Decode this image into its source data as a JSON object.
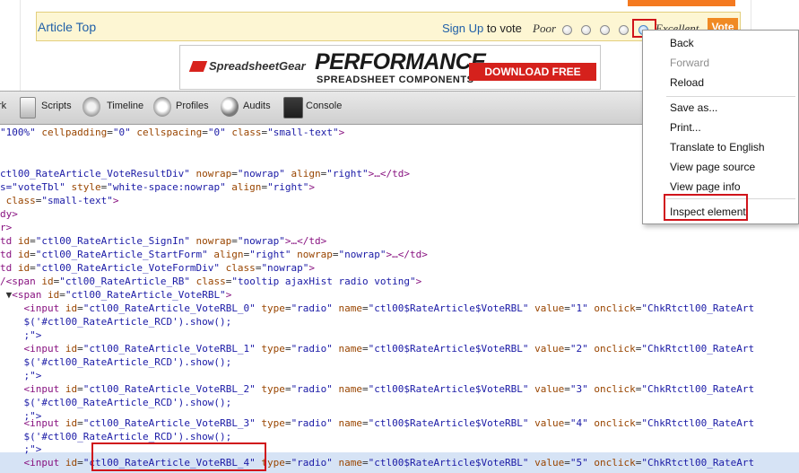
{
  "page": {
    "article_top": "Article Top",
    "sign_up": "Sign Up",
    "to_vote": "to vote",
    "poor_label": "Poor",
    "excellent_label": "Excellent",
    "vote_label": "Vote"
  },
  "ad": {
    "brand": "SpreadsheetGear",
    "headline": "PERFORMANCE",
    "subtitle": "SPREADSHEET COMPONENTS",
    "cta": "DOWNLOAD FREE TRIAL"
  },
  "devtools": {
    "tabs": [
      "rk",
      "Scripts",
      "Timeline",
      "Profiles",
      "Audits",
      "Console"
    ]
  },
  "menu": {
    "back": "Back",
    "forward": "Forward",
    "reload": "Reload",
    "save_as": "Save as...",
    "print": "Print...",
    "translate": "Translate to English",
    "view_source": "View page source",
    "view_page_info": "View page info",
    "inspect": "Inspect element"
  },
  "dom": {
    "eq": "=",
    "gt": ">",
    "indent": "    ",
    "id_attr": " id",
    "class_attr": " class",
    "type_attr": " type",
    "name_attr": " name",
    "value_attr": " value",
    "onclick_attr": " onclick",
    "nowrap_attr": " nowrap",
    "align_attr": " align",
    "nowrap_val": "\"nowrap\"",
    "right_val": "\"right\"",
    "radio_val": "\"radio\"",
    "name_val": "\"ctl00$RateArticle$VoteRBL\"",
    "onclick_val": "\"ChkRtctl00_RateArt",
    "input_open": "<input",
    "show_call": "$('#ctl00_RateArticle_RCD').show();",
    "close_q": ";\">",
    "l1a": "\"100%\"",
    "l1b": " cellpadding",
    "l1c": "\"0\"",
    "l1d": " cellspacing",
    "l1e": "\"0\"",
    "l1f": " class",
    "l1g": "\"small-text\"",
    "l3a": "ctl00_RateArticle_VoteResultDiv\"",
    "l3b": " nowrap",
    "l3c": "\"nowrap\"",
    "l3d": " align",
    "l3e": "\"right\"",
    "l3f": ">…</td>",
    "l4a": "s=\"voteTbl\"",
    "l4b": " style",
    "l4c": "\"white-space:nowrap\"",
    "l4d": " align",
    "l4e": "\"right\"",
    "l5a": " class",
    "l5b": "\"small-text\"",
    "l6": "dy>",
    "l7": "r>",
    "l8a": "td",
    "l8b": "\"ctl00_RateArticle_SignIn\"",
    "l8c": ">…</td>",
    "l9a": "\"ctl00_RateArticle_StartForm\"",
    "l10a": "\"ctl00_RateArticle_VoteFormDiv\"",
    "l10b": "\"nowrap\"",
    "l11a": "/<span",
    "l11b": "\"ctl00_RateArticle_RB\"",
    "l11c": "\"tooltip ajaxHist radio voting\"",
    "l12a": " ▼",
    "l12b": "<span",
    "l12c": "\"ctl00_RateArticle_VoteRBL\"",
    "inputs": [
      {
        "id": "\"ctl00_RateArticle_VoteRBL_0\"",
        "value": "\"1\""
      },
      {
        "id": "\"ctl00_RateArticle_VoteRBL_1\"",
        "value": "\"2\""
      },
      {
        "id": "\"ctl00_RateArticle_VoteRBL_2\"",
        "value": "\"3\""
      },
      {
        "id": "\"ctl00_RateArticle_VoteRBL_3\"",
        "value": "\"4\""
      },
      {
        "id": "\"ctl00_RateArticle_VoteRBL_4\"",
        "value": "\"5\""
      }
    ]
  }
}
